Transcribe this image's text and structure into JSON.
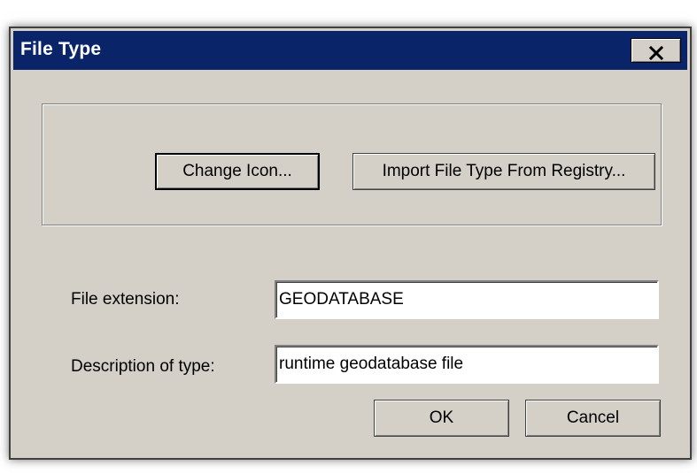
{
  "window": {
    "title": "File Type"
  },
  "icon_group": {
    "change_icon_label": "Change Icon...",
    "import_label": "Import File Type From Registry..."
  },
  "form": {
    "extension_label": "File extension:",
    "extension_value": "GEODATABASE",
    "description_label": "Description of type:",
    "description_value": "runtime geodatabase file"
  },
  "actions": {
    "ok_label": "OK",
    "cancel_label": "Cancel"
  },
  "icons": {
    "close": "close-icon"
  },
  "colors": {
    "titlebar": "#0a246a",
    "dialog_face": "#d4d0c8"
  }
}
